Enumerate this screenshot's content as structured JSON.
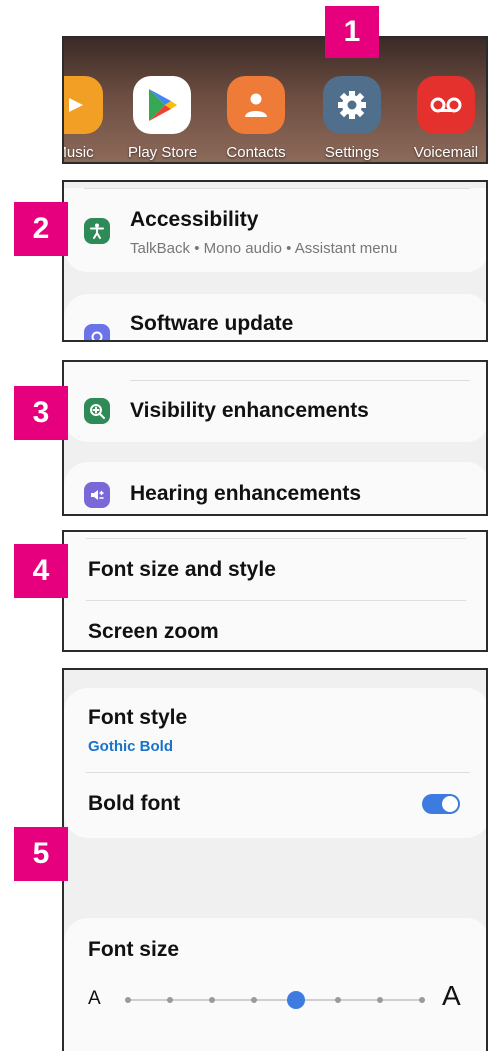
{
  "steps": [
    "1",
    "2",
    "3",
    "4",
    "5"
  ],
  "home": {
    "apps": [
      {
        "label": "Music",
        "icon": "music-icon",
        "color": "#f2a025"
      },
      {
        "label": "Play Store",
        "icon": "play-store-icon",
        "color": "#ffffff"
      },
      {
        "label": "Contacts",
        "icon": "contacts-icon",
        "color": "#ee7b37"
      },
      {
        "label": "Settings",
        "icon": "gear-icon",
        "color": "#4f6f8c"
      },
      {
        "label": "Voicemail",
        "icon": "voicemail-icon",
        "color": "#e5312e"
      }
    ]
  },
  "settings": {
    "accessibility": {
      "title": "Accessibility",
      "subtitle": "TalkBack  •  Mono audio  •  Assistant menu",
      "icon": "accessibility-icon",
      "color": "#2e8b57"
    },
    "software_update": {
      "title": "Software update",
      "icon": "software-update-icon",
      "color": "#6b73e8"
    }
  },
  "accessibility_menu": {
    "visibility": {
      "title": "Visibility enhancements",
      "icon": "zoom-in-icon",
      "color": "#2e8b57"
    },
    "hearing": {
      "title": "Hearing enhancements",
      "icon": "hearing-icon",
      "color": "#7b68d8"
    }
  },
  "visibility_menu": {
    "font_size_style": "Font size and style",
    "screen_zoom": "Screen zoom"
  },
  "font_menu": {
    "font_style": {
      "title": "Font style",
      "value": "Gothic Bold",
      "value_color": "#1a73c9"
    },
    "bold_font": {
      "title": "Bold font",
      "enabled": true,
      "toggle_color": "#3d7be0"
    },
    "font_size": {
      "title": "Font size",
      "small_label": "A",
      "large_label": "A",
      "steps": 8,
      "selected_step": 5
    }
  },
  "colors": {
    "badge": "#e6007e"
  }
}
